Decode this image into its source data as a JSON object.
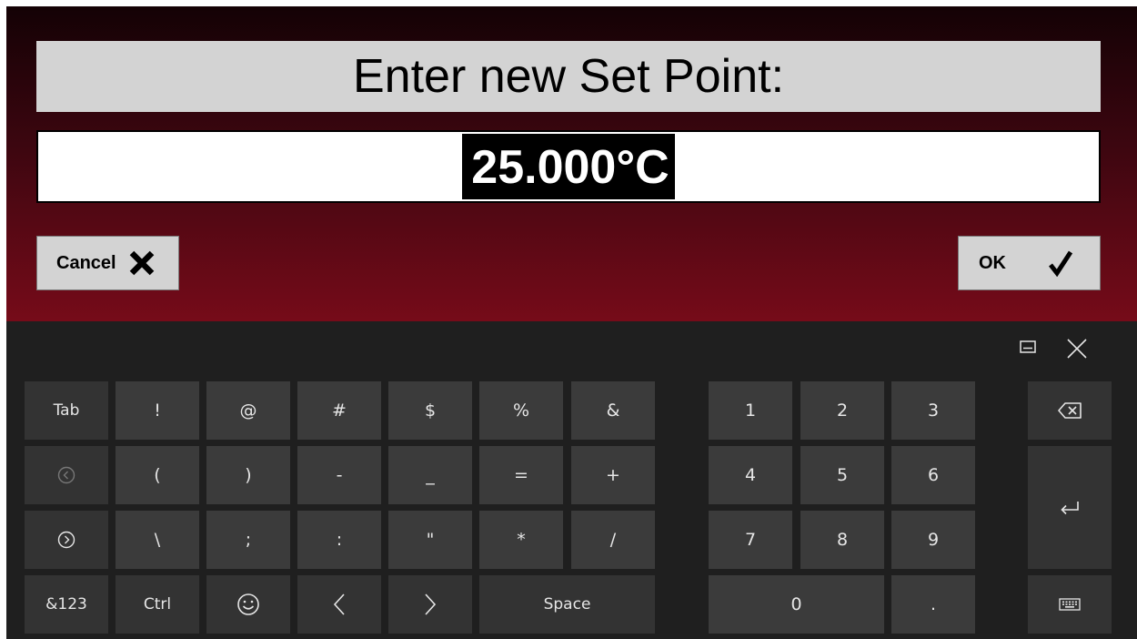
{
  "dialog": {
    "prompt": "Enter new Set Point:",
    "value": "25.000°C",
    "cancel_label": "Cancel",
    "ok_label": "OK"
  },
  "keyboard": {
    "toolbar_icons": [
      "dock-keyboard-icon",
      "close-icon"
    ],
    "row1": [
      "Tab",
      "!",
      "@",
      "#",
      "$",
      "%",
      "&",
      "1",
      "2",
      "3"
    ],
    "row2": [
      "(",
      ")",
      "-",
      "_",
      "=",
      "+",
      "4",
      "5",
      "6"
    ],
    "row3": [
      "\\",
      ";",
      ":",
      "\"",
      "*",
      "/",
      "7",
      "8",
      "9"
    ],
    "row4": {
      "symbols": "&123",
      "ctrl": "Ctrl",
      "space": "Space",
      "zero": "0",
      "dot": "."
    },
    "icon_keys": [
      "backspace-icon",
      "enter-icon",
      "circle-left-icon",
      "circle-right-icon",
      "emoji-icon",
      "chevron-left-icon",
      "chevron-right-icon",
      "keyboard-icon"
    ]
  },
  "colors": {
    "gradient_top": "#140205",
    "gradient_bottom": "#760b19",
    "dialog_gray": "#d3d3d3",
    "keyboard_bg": "#1f1f1f",
    "key_bg": "#3b3b3b",
    "key_text": "#e6e6e6"
  }
}
